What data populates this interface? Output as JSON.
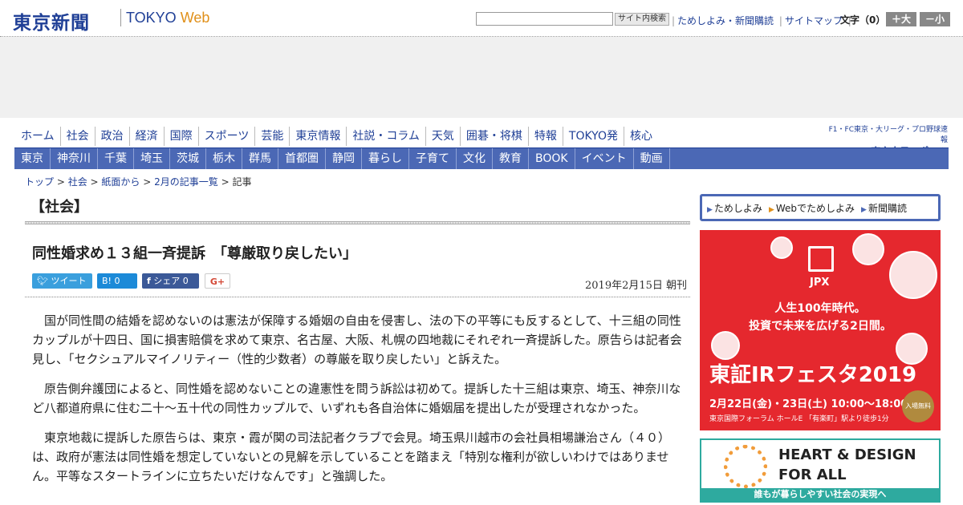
{
  "header": {
    "logo_jp": "東京新聞",
    "logo_en_main": "TOKYO ",
    "logo_en_accent": "Web",
    "search_button": "サイト内検索",
    "links": [
      "ためしよみ・新聞購読",
      "サイトマップ"
    ],
    "fontsize_label": "文字（0）",
    "font_larger": "＋大",
    "font_smaller": "－小"
  },
  "nav_primary": [
    "ホーム",
    "社会",
    "政治",
    "経済",
    "国際",
    "スポーツ",
    "芸能",
    "東京情報",
    "社説・コラム",
    "天気",
    "囲碁・将棋",
    "特報",
    "TOKYO発",
    "核心"
  ],
  "nav_secondary": [
    "東京",
    "神奈川",
    "千葉",
    "埼玉",
    "茨城",
    "栃木",
    "群馬",
    "首都圏",
    "静岡",
    "暮らし",
    "子育て",
    "文化",
    "教育",
    "BOOK",
    "イベント",
    "動画"
  ],
  "chunichi": {
    "line1": "F1・FC東京・大リーグ・プロ野球速報",
    "line2": "東京中日スポーツ"
  },
  "breadcrumb": [
    "トップ",
    "社会",
    "紙面から",
    "2月の記事一覧"
  ],
  "breadcrumb_current": "記事",
  "article": {
    "section": "【社会】",
    "headline": "同性婚求め１３組一斉提訴　「尊厳取り戻したい」",
    "share": {
      "tweet": "ツイート",
      "hatena": "B! 0",
      "facebook": "シェア 0",
      "gplus": "G+"
    },
    "date": "2019年2月15日 朝刊",
    "paragraphs": [
      "国が同性間の結婚を認めないのは憲法が保障する婚姻の自由を侵害し、法の下の平等にも反するとして、十三組の同性カップルが十四日、国に損害賠償を求めて東京、名古屋、大阪、札幌の四地裁にそれぞれ一斉提訴した。原告らは記者会見し、「セクシュアルマイノリティー（性的少数者）の尊厳を取り戻したい」と訴えた。",
      "原告側弁護団によると、同性婚を認めないことの違憲性を問う訴訟は初めて。提訴した十三組は東京、埼玉、神奈川など八都道府県に住む二十～五十代の同性カップルで、いずれも各自治体に婚姻届を提出したが受理されなかった。",
      "東京地裁に提訴した原告らは、東京・霞が関の司法記者クラブで会見。埼玉県川越市の会社員相場謙治さん（４０）は、政府が憲法は同性婚を想定していないとの見解を示していることを踏まえ「特別な権利が欲しいわけではありません。平等なスタートラインに立ちたいだけなんです」と強調した。"
    ]
  },
  "sidebar": {
    "links": [
      "ためしよみ",
      "Webでためしよみ",
      "新聞購読"
    ],
    "ad_jpx": {
      "brand": "JPX",
      "line1": "人生100年時代。",
      "line2": "投資で未来を広げる2日間。",
      "title": "東証IRフェスタ2019",
      "dates": "2月22日(金)・23日(土) 10:00～18:00",
      "venue": "東京国際フォーラム ホールE 「有楽町」駅より徒歩1分",
      "badge": "入場無料"
    },
    "ad_heart": {
      "line1": "HEART & DESIGN",
      "line2": "FOR ALL",
      "line3": "誰もが暮らしやすい社会の実現へ"
    }
  }
}
